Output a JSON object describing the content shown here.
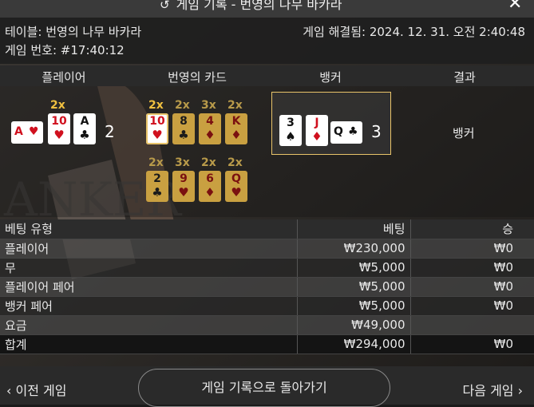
{
  "title": {
    "text": "게임 기록 - 번영의 나무 바카라",
    "close": "✕"
  },
  "info": {
    "table": "테이블: 번영의 나무 바카라",
    "game_no": "게임 번호: #17:40:12",
    "resolved": "게임 해결됨: 2024. 12. 31. 오전 2:40:48"
  },
  "card_header": {
    "player": "플레이어",
    "prosperity": "번영의 카드",
    "banker": "뱅커",
    "result": "결과"
  },
  "player": {
    "cards": [
      {
        "rank": "A",
        "suit": "♥",
        "color": "red",
        "sideways": true
      },
      {
        "rank": "10",
        "suit": "♥",
        "color": "red",
        "multiplier": "2x"
      },
      {
        "rank": "A",
        "suit": "♣",
        "color": "black"
      }
    ],
    "score": "2"
  },
  "prosperity": {
    "row1": [
      {
        "rank": "10",
        "suit": "♥",
        "color": "red",
        "multiplier": "2x",
        "highlight": true
      },
      {
        "rank": "8",
        "suit": "♣",
        "color": "black",
        "multiplier": "2x"
      },
      {
        "rank": "4",
        "suit": "♦",
        "color": "red",
        "multiplier": "3x"
      },
      {
        "rank": "K",
        "suit": "♦",
        "color": "red",
        "multiplier": "2x"
      }
    ],
    "row2": [
      {
        "rank": "2",
        "suit": "♣",
        "color": "black",
        "multiplier": "2x"
      },
      {
        "rank": "9",
        "suit": "♥",
        "color": "red",
        "multiplier": "3x"
      },
      {
        "rank": "6",
        "suit": "♦",
        "color": "red",
        "multiplier": "2x"
      },
      {
        "rank": "Q",
        "suit": "♥",
        "color": "red",
        "multiplier": "2x"
      }
    ]
  },
  "banker": {
    "cards": [
      {
        "rank": "3",
        "suit": "♠",
        "color": "black"
      },
      {
        "rank": "J",
        "suit": "♦",
        "color": "red"
      },
      {
        "rank": "Q",
        "suit": "♣",
        "color": "black",
        "sideways": true
      }
    ],
    "score": "3"
  },
  "result": "뱅커",
  "bets": {
    "headers": {
      "type": "베팅 유형",
      "bet": "베팅",
      "win": "승"
    },
    "rows": [
      {
        "type": "플레이어",
        "bet": "₩230,000",
        "win": "₩0"
      },
      {
        "type": "무",
        "bet": "₩5,000",
        "win": "₩0"
      },
      {
        "type": "플레이어 페어",
        "bet": "₩5,000",
        "win": "₩0"
      },
      {
        "type": "뱅커 페어",
        "bet": "₩5,000",
        "win": "₩0"
      },
      {
        "type": "요금",
        "bet": "₩49,000",
        "win": ""
      }
    ],
    "total": {
      "type": "합계",
      "bet": "₩294,000",
      "win": "₩0"
    }
  },
  "footer": {
    "prev": "‹  이전 게임",
    "back": "게임 기록으로 돌아가기",
    "next": "다음 게임  ›"
  },
  "icons": {
    "history": "history-icon",
    "close": "close-icon",
    "chevron_left": "chevron-left-icon",
    "chevron_right": "chevron-right-icon"
  }
}
